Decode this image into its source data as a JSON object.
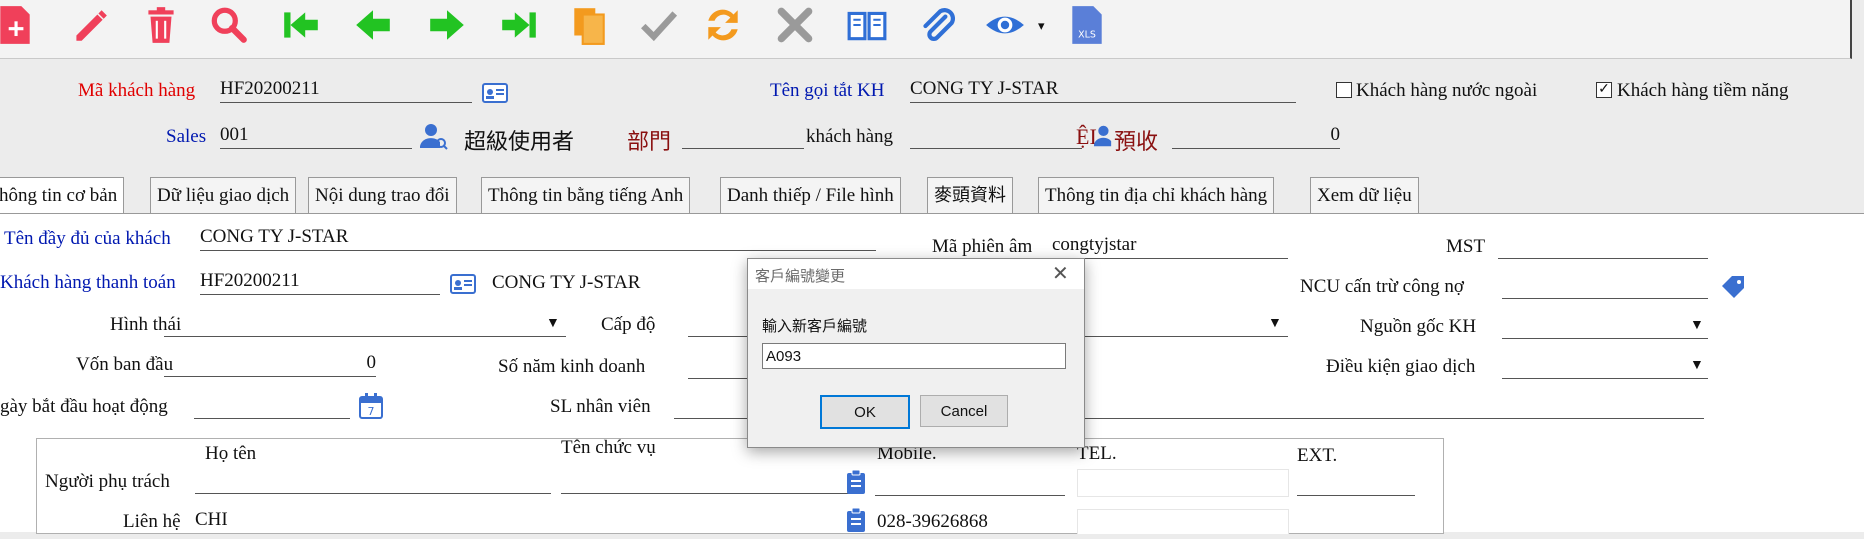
{
  "header": {
    "customer_code_label": "Mã khách hàng",
    "customer_code_value": "HF20200211",
    "short_name_label": "Tên gọi tắt KH",
    "short_name_value": "CONG TY J-STAR",
    "foreign_customer_label": "Khách hàng nước ngoài",
    "foreign_customer_checked": false,
    "potential_customer_label": "Khách hàng tiềm năng",
    "potential_customer_checked": true,
    "sales_label": "Sales",
    "sales_value": "001",
    "sales_name": "超級使用者",
    "department_label": "部門",
    "department_value": "",
    "customer_label": "khách hàng",
    "customer_value": "",
    "prepaid_label": "預收",
    "prepaid_prefix": "ỆI",
    "prepaid_value": "0"
  },
  "tabs": [
    {
      "label": "hông tin cơ bản"
    },
    {
      "label": "Dữ liệu giao dịch"
    },
    {
      "label": "Nội dung trao đổi"
    },
    {
      "label": "Thông tin bằng tiếng Anh"
    },
    {
      "label": "Danh thiếp / File hình"
    },
    {
      "label": "麥頭資料"
    },
    {
      "label": "Thông tin địa chỉ khách hàng"
    },
    {
      "label": "Xem dữ liệu"
    }
  ],
  "form": {
    "full_name_label": "Tên đầy đủ của khách",
    "full_name_value": "CONG TY J-STAR",
    "phonetic_label": "Mã phiên âm",
    "phonetic_value": "congtyjstar",
    "tax_label": "MST",
    "tax_value": "",
    "billing_label": "Khách hàng thanh toán",
    "billing_value": "HF20200211",
    "billing_name": "CONG TY J-STAR",
    "ncu_label": "NCU cấn trừ công nợ",
    "ncu_value": "",
    "type_label": "Hình thái",
    "level_label": "Cấp độ",
    "origin_label": "Nguồn gốc KH",
    "capital_label": "Vốn ban đầu",
    "capital_value": "0",
    "years_label": "Số năm kinh doanh",
    "terms_label": "Điều kiện giao dịch",
    "start_date_label": "gày bắt đầu hoạt động",
    "staff_label": "SL nhân viên"
  },
  "contacts": {
    "name_header": "Họ tên",
    "position_header": "Tên chức vụ",
    "mobile_header": "Mobile.",
    "tel_header": "TEL.",
    "ext_header": "EXT.",
    "person_in_charge_label": "Người phụ trách",
    "contact_label": "Liên hệ",
    "contact_name": "CHI",
    "contact_mobile": "028-39626868"
  },
  "dialog": {
    "title": "客戶編號變更",
    "prompt": "輸入新客戶編號",
    "input_value": "A093",
    "ok_label": "OK",
    "cancel_label": "Cancel"
  },
  "colors": {
    "required_label": "#e00000",
    "link_label": "#0018b0",
    "green_nav": "#22c322",
    "orange_icon": "#f39a1e",
    "blue_icon": "#2f6fd6"
  },
  "icons": [
    "new-doc-icon",
    "edit-icon",
    "delete-icon",
    "search-icon",
    "first-record-icon",
    "prev-record-icon",
    "next-record-icon",
    "last-record-icon",
    "copy-icon",
    "confirm-icon",
    "refresh-icon",
    "cancel-icon",
    "book-icon",
    "attach-icon",
    "view-icon",
    "excel-icon"
  ]
}
